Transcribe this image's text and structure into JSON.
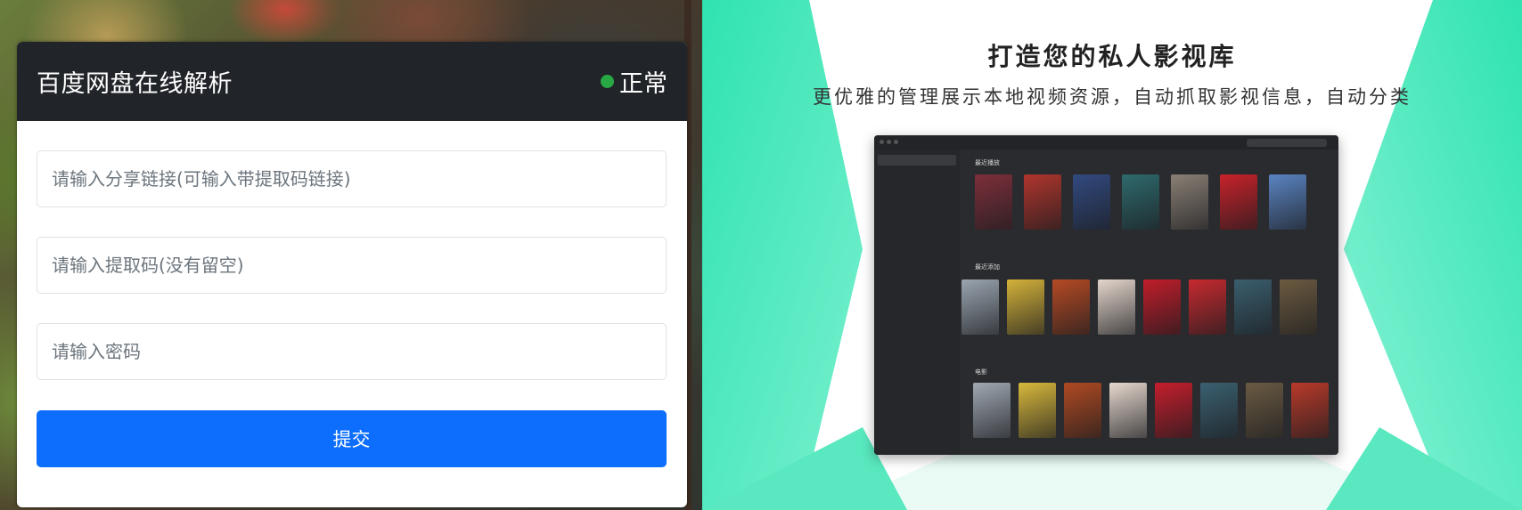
{
  "card": {
    "title": "百度网盘在线解析",
    "status_label": "正常",
    "status_color": "#28a745",
    "link_placeholder": "请输入分享链接(可输入带提取码链接)",
    "code_placeholder": "请输入提取码(没有留空)",
    "password_placeholder": "请输入密码",
    "submit_label": "提交",
    "accent": "#0d6efd"
  },
  "promo": {
    "title": "打造您的私人影视库",
    "subtitle": "更优雅的管理展示本地视频资源，自动抓取影视信息，自动分类",
    "app": {
      "sections": [
        "最近播放",
        "最近添加",
        "电影"
      ],
      "posters": [
        [
          "#7d2f3a",
          "#b0352d",
          "#324a80",
          "#2e6a6d",
          "#8a8075",
          "#c8222a",
          "#5a84c2"
        ],
        [
          "#9aa5b0",
          "#d4b23a",
          "#b54a24",
          "#e4d6cc",
          "#c01d2a",
          "#c62a2f",
          "#3a5e6e",
          "#6b5a40"
        ],
        [
          "#a0a8b2",
          "#d8b83c",
          "#b04a22",
          "#e6d8ce",
          "#c41e2c",
          "#3a6070",
          "#6a5a42",
          "#b83a2a"
        ]
      ]
    }
  }
}
